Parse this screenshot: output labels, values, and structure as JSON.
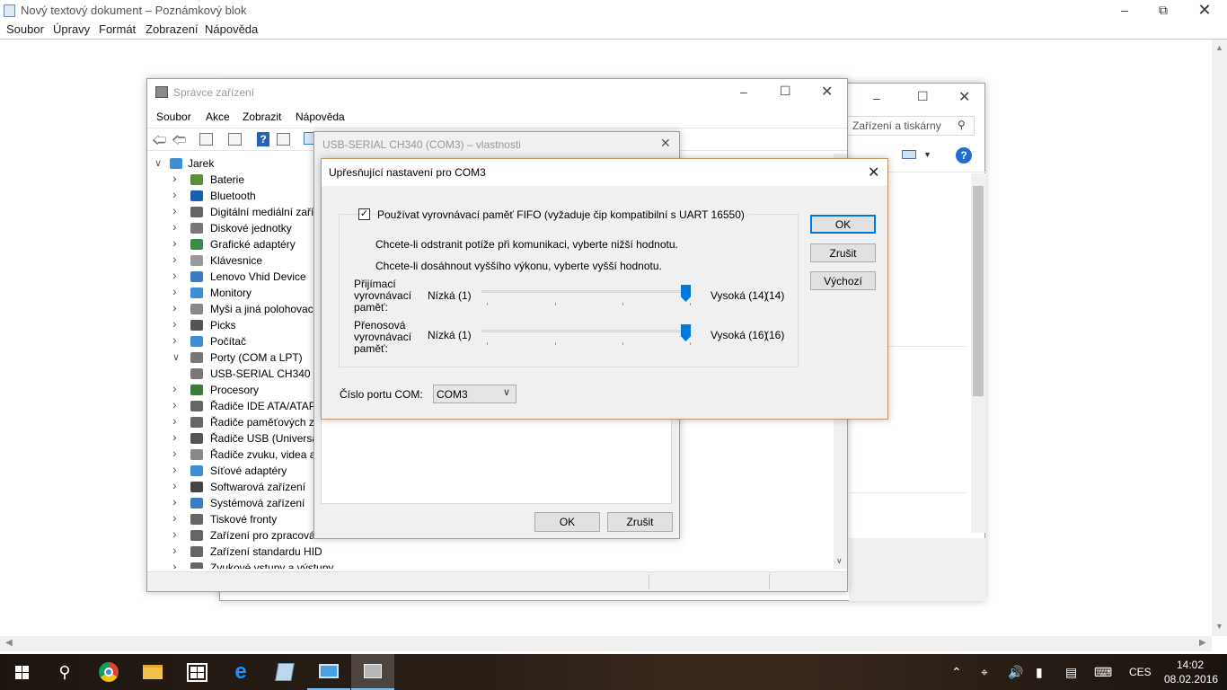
{
  "notepad": {
    "title": "Nový textový dokument – Poznámkový blok",
    "menu": [
      "Soubor",
      "Úpravy",
      "Formát",
      "Zobrazení",
      "Nápověda"
    ]
  },
  "bgwin": {
    "search_placeholder": "Zařízení a tiskárny"
  },
  "devmgr": {
    "title": "Správce zařízení",
    "menu": [
      "Soubor",
      "Akce",
      "Zobrazit",
      "Nápověda"
    ],
    "root": "Jarek",
    "items": [
      {
        "label": "Baterie",
        "color": "#5a8f3a"
      },
      {
        "label": "Bluetooth",
        "color": "#1a5fb4"
      },
      {
        "label": "Digitální mediální zaříz",
        "color": "#666666"
      },
      {
        "label": "Diskové jednotky",
        "color": "#777777"
      },
      {
        "label": "Grafické adaptéry",
        "color": "#3c8a4a"
      },
      {
        "label": "Klávesnice",
        "color": "#999999"
      },
      {
        "label": "Lenovo Vhid Device",
        "color": "#3b7dc4"
      },
      {
        "label": "Monitory",
        "color": "#3b8fd4"
      },
      {
        "label": "Myši a jiná polohovací",
        "color": "#888888"
      },
      {
        "label": "Picks",
        "color": "#555555"
      },
      {
        "label": "Počítač",
        "color": "#3b8fd4"
      },
      {
        "label": "Porty (COM a LPT)",
        "color": "#777777"
      },
      {
        "label": "USB-SERIAL CH340",
        "color": "#777777"
      },
      {
        "label": "Procesory",
        "color": "#3c7a3a"
      },
      {
        "label": "Řadiče IDE ATA/ATAPI",
        "color": "#666666"
      },
      {
        "label": "Řadiče paměťových zaří",
        "color": "#666666"
      },
      {
        "label": "Řadiče USB (Universal S",
        "color": "#555555"
      },
      {
        "label": "Řadiče zvuku, videa a h",
        "color": "#888888"
      },
      {
        "label": "Síťové adaptéry",
        "color": "#3b8fd4"
      },
      {
        "label": "Softwarová zařízení",
        "color": "#444444"
      },
      {
        "label": "Systémová zařízení",
        "color": "#3b7dc4"
      },
      {
        "label": "Tiskové fronty",
        "color": "#666666"
      },
      {
        "label": "Zařízení pro zpracování",
        "color": "#666666"
      },
      {
        "label": "Zařízení standardu HID",
        "color": "#666666"
      },
      {
        "label": "Zvukové vstupy a výstupy",
        "color": "#666666"
      }
    ]
  },
  "props": {
    "title": "USB-SERIAL CH340 (COM3) – vlastnosti",
    "ok": "OK",
    "cancel": "Zrušit"
  },
  "adv": {
    "title": "Upřesňující nastavení pro COM3",
    "fifo_label": "Používat vyrovnávací paměť FIFO (vyžaduje čip kompatibilní s UART 16550)",
    "fifo_checked": true,
    "hint1": "Chcete-li odstranit potíže při komunikaci, vyberte nižší hodnotu.",
    "hint2": "Chcete-li dosáhnout vyššího výkonu, vyberte vyšší hodnotu.",
    "rx_label": "Přijímací vyrovnávací paměť:",
    "rx_low": "Nízká (1)",
    "rx_high": "Vysoká (14)",
    "rx_value": "(14)",
    "rx_fraction": 1.0,
    "tx_label": "Přenosová vyrovnávací paměť:",
    "tx_low": "Nízká (1)",
    "tx_high": "Vysoká (16)",
    "tx_value": "(16)",
    "tx_fraction": 1.0,
    "port_label": "Číslo portu COM:",
    "port_value": "COM3",
    "ok": "OK",
    "cancel": "Zrušit",
    "defaults": "Výchozí"
  },
  "tray": {
    "lang": "CES",
    "time": "14:02",
    "date": "08.02.2016"
  }
}
